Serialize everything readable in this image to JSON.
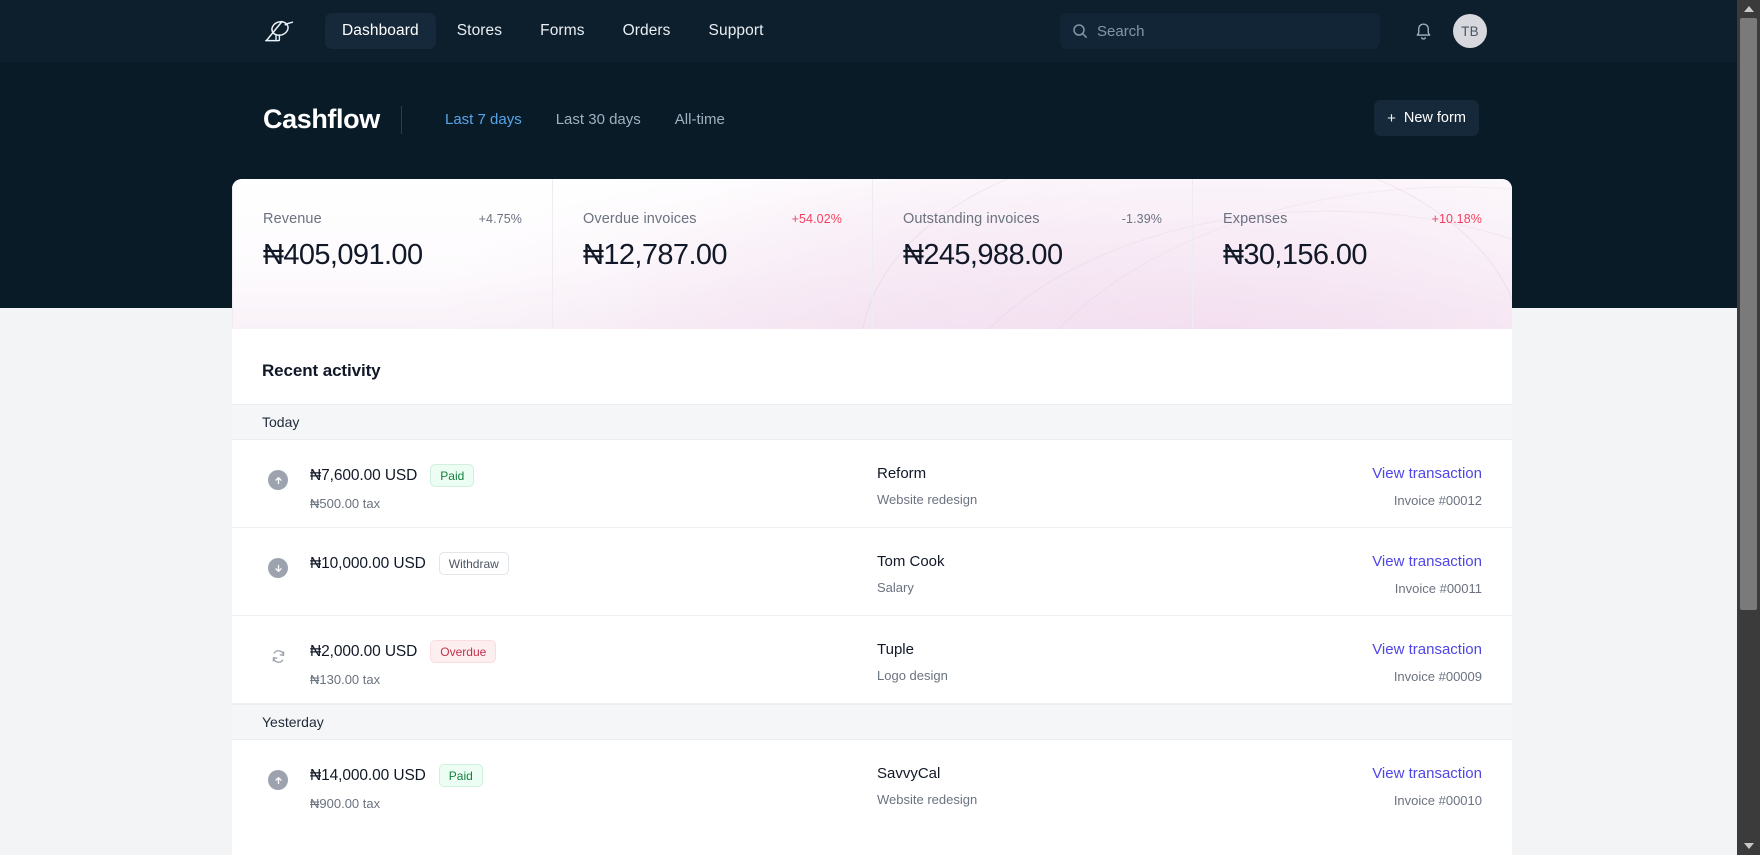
{
  "navbar": {
    "logo_name": "bird-logo",
    "links": [
      {
        "label": "Dashboard",
        "active": true
      },
      {
        "label": "Stores",
        "active": false
      },
      {
        "label": "Forms",
        "active": false
      },
      {
        "label": "Orders",
        "active": false
      },
      {
        "label": "Support",
        "active": false
      }
    ],
    "search": {
      "placeholder": "Search",
      "value": ""
    },
    "notifications_icon": "bell-icon",
    "avatar_initials": "TB"
  },
  "page_header": {
    "title": "Cashflow",
    "range_tabs": [
      {
        "label": "Last 7 days",
        "active": true
      },
      {
        "label": "Last 30 days",
        "active": false
      },
      {
        "label": "All-time",
        "active": false
      }
    ],
    "new_form_label": "New form",
    "new_form_icon": "plus-icon"
  },
  "stats": [
    {
      "label": "Revenue",
      "delta": "+4.75%",
      "delta_kind": "neutral",
      "value": "₦405,091.00"
    },
    {
      "label": "Overdue invoices",
      "delta": "+54.02%",
      "delta_kind": "up",
      "value": "₦12,787.00"
    },
    {
      "label": "Outstanding invoices",
      "delta": "-1.39%",
      "delta_kind": "neutral",
      "value": "₦245,988.00"
    },
    {
      "label": "Expenses",
      "delta": "+10.18%",
      "delta_kind": "up",
      "value": "₦30,156.00"
    }
  ],
  "activity": {
    "title": "Recent activity",
    "groups": [
      {
        "day": "Today",
        "rows": [
          {
            "icon": "arrow-up-circle-icon",
            "amount": "₦7,600.00 USD",
            "badge": "Paid",
            "badge_kind": "paid",
            "tax": "₦500.00 tax",
            "client": "Reform",
            "description": "Website redesign",
            "link": "View transaction",
            "invoice": "Invoice #00012"
          },
          {
            "icon": "arrow-down-circle-icon",
            "amount": "₦10,000.00 USD",
            "badge": "Withdraw",
            "badge_kind": "withdraw",
            "tax": "",
            "client": "Tom Cook",
            "description": "Salary",
            "link": "View transaction",
            "invoice": "Invoice #00011"
          },
          {
            "icon": "refresh-icon",
            "amount": "₦2,000.00 USD",
            "badge": "Overdue",
            "badge_kind": "overdue",
            "tax": "₦130.00 tax",
            "client": "Tuple",
            "description": "Logo design",
            "link": "View transaction",
            "invoice": "Invoice #00009"
          }
        ]
      },
      {
        "day": "Yesterday",
        "rows": [
          {
            "icon": "arrow-up-circle-icon",
            "amount": "₦14,000.00 USD",
            "badge": "Paid",
            "badge_kind": "paid",
            "tax": "₦900.00 tax",
            "client": "SavvyCal",
            "description": "Website redesign",
            "link": "View transaction",
            "invoice": "Invoice #00010"
          }
        ]
      }
    ]
  },
  "colors": {
    "header_bg": "#0a1b28",
    "navbar_bg": "#0d1f2d",
    "accent_tab": "#56a5e8",
    "link": "#4f46e5",
    "delta_up": "#f43f5e",
    "badge_paid": "#15803d",
    "badge_overdue": "#c4324b"
  }
}
